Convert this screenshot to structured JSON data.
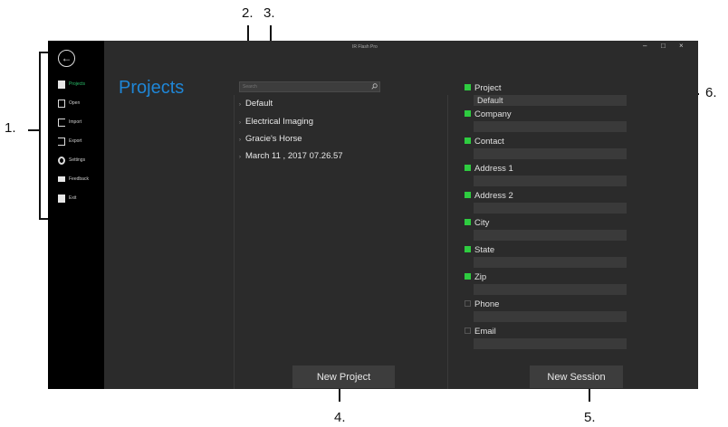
{
  "callouts": [
    "1.",
    "2.",
    "3.",
    "4.",
    "5.",
    "6."
  ],
  "app": {
    "window_title": "IR Flash Pro",
    "window_controls": [
      "–",
      "□",
      "×"
    ],
    "page_title": "Projects",
    "sidebar": {
      "back_icon": "arrow-left-circle-icon",
      "items": [
        {
          "label": "Projects",
          "icon": "document-icon",
          "active": true
        },
        {
          "label": "Open",
          "icon": "folder-open-icon",
          "active": false
        },
        {
          "label": "Import",
          "icon": "import-icon",
          "active": false
        },
        {
          "label": "Export",
          "icon": "export-icon",
          "active": false
        },
        {
          "label": "Settings",
          "icon": "gear-icon",
          "active": false
        },
        {
          "label": "Feedback",
          "icon": "feedback-icon",
          "active": false
        },
        {
          "label": "Exit",
          "icon": "exit-icon",
          "active": false
        }
      ]
    },
    "search": {
      "placeholder": "Search",
      "value": ""
    },
    "projects": [
      "Default",
      "Electrical Imaging",
      "Gracie's Horse",
      "March 11 , 2017 07.26.57"
    ],
    "fields": [
      {
        "label": "Project",
        "value": "Default",
        "checked": true
      },
      {
        "label": "Company",
        "value": "",
        "checked": true
      },
      {
        "label": "Contact",
        "value": "",
        "checked": true
      },
      {
        "label": "Address 1",
        "value": "",
        "checked": true
      },
      {
        "label": "Address 2",
        "value": "",
        "checked": true
      },
      {
        "label": "City",
        "value": "",
        "checked": true
      },
      {
        "label": "State",
        "value": "",
        "checked": true
      },
      {
        "label": "Zip",
        "value": "",
        "checked": true
      },
      {
        "label": "Phone",
        "value": "",
        "checked": false
      },
      {
        "label": "Email",
        "value": "",
        "checked": false
      }
    ],
    "buttons": {
      "new_project": "New Project",
      "new_session": "New Session"
    }
  },
  "colors": {
    "accent": "#1f86d6",
    "active_nav": "#29c06a",
    "checkbox_on": "#2ecc40",
    "background": "#2b2b2b",
    "sidebar": "#000000"
  }
}
